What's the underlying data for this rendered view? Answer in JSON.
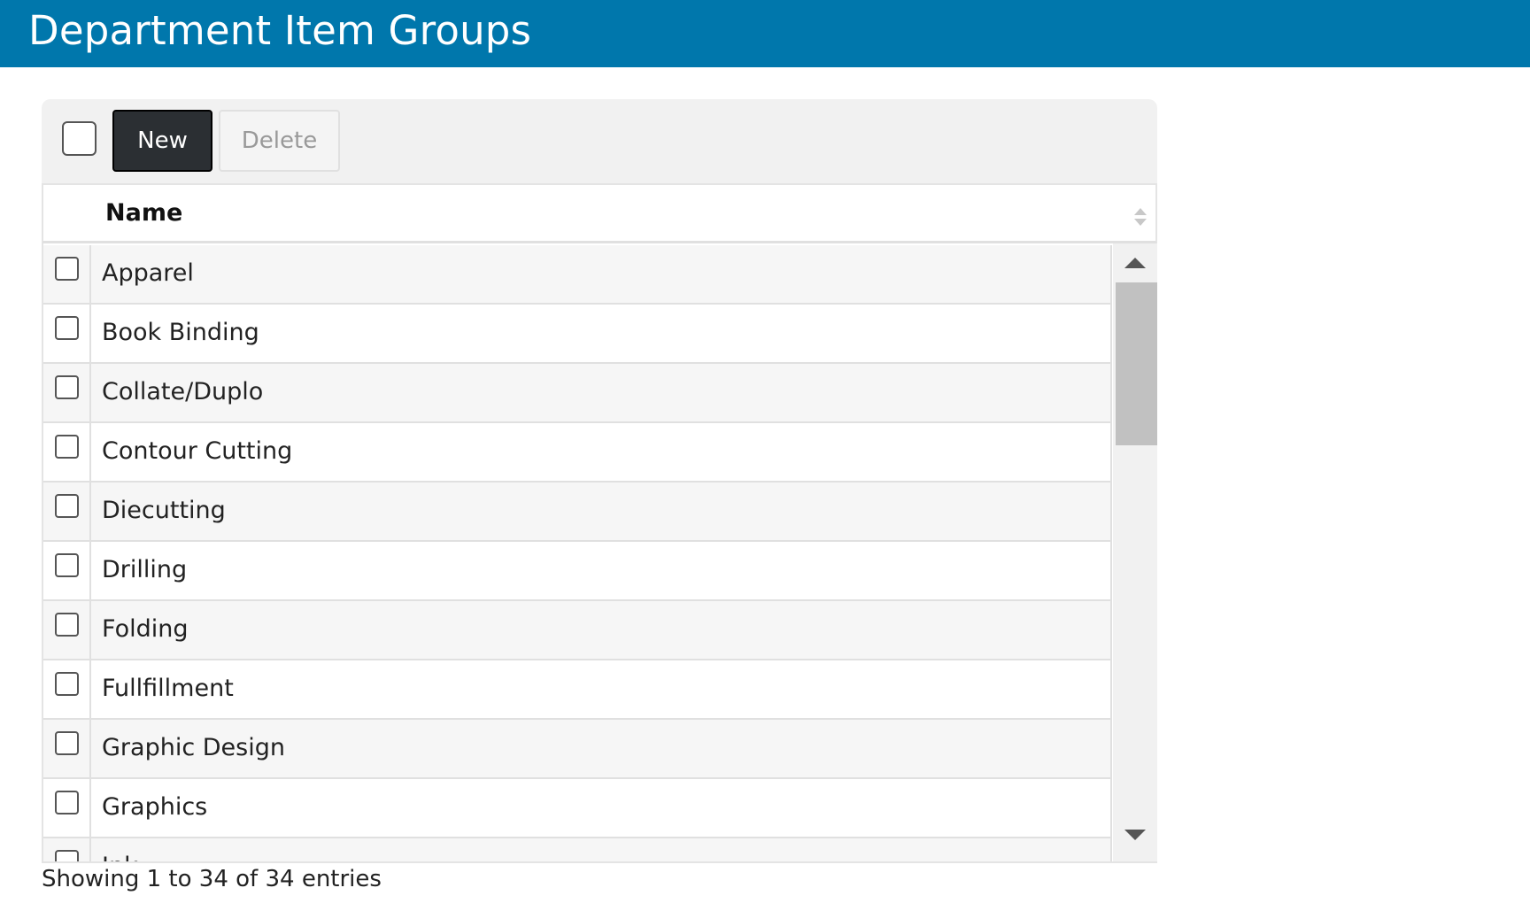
{
  "header": {
    "title": "Department Item Groups"
  },
  "toolbar": {
    "new_label": "New",
    "delete_label": "Delete"
  },
  "table": {
    "column_name": "Name",
    "rows": [
      "Apparel",
      "Book Binding",
      "Collate/Duplo",
      "Contour Cutting",
      "Diecutting",
      "Drilling",
      "Folding",
      "Fullfillment",
      "Graphic Design",
      "Graphics",
      "Ink"
    ]
  },
  "footer": {
    "info": "Showing 1 to 34 of 34 entries"
  },
  "colors": {
    "header_bg": "#0077ac",
    "new_button_bg": "#2b2f33"
  },
  "icons": {
    "sort": "sort-both-icon",
    "scroll_up": "arrow-up-icon",
    "scroll_down": "arrow-down-icon"
  }
}
